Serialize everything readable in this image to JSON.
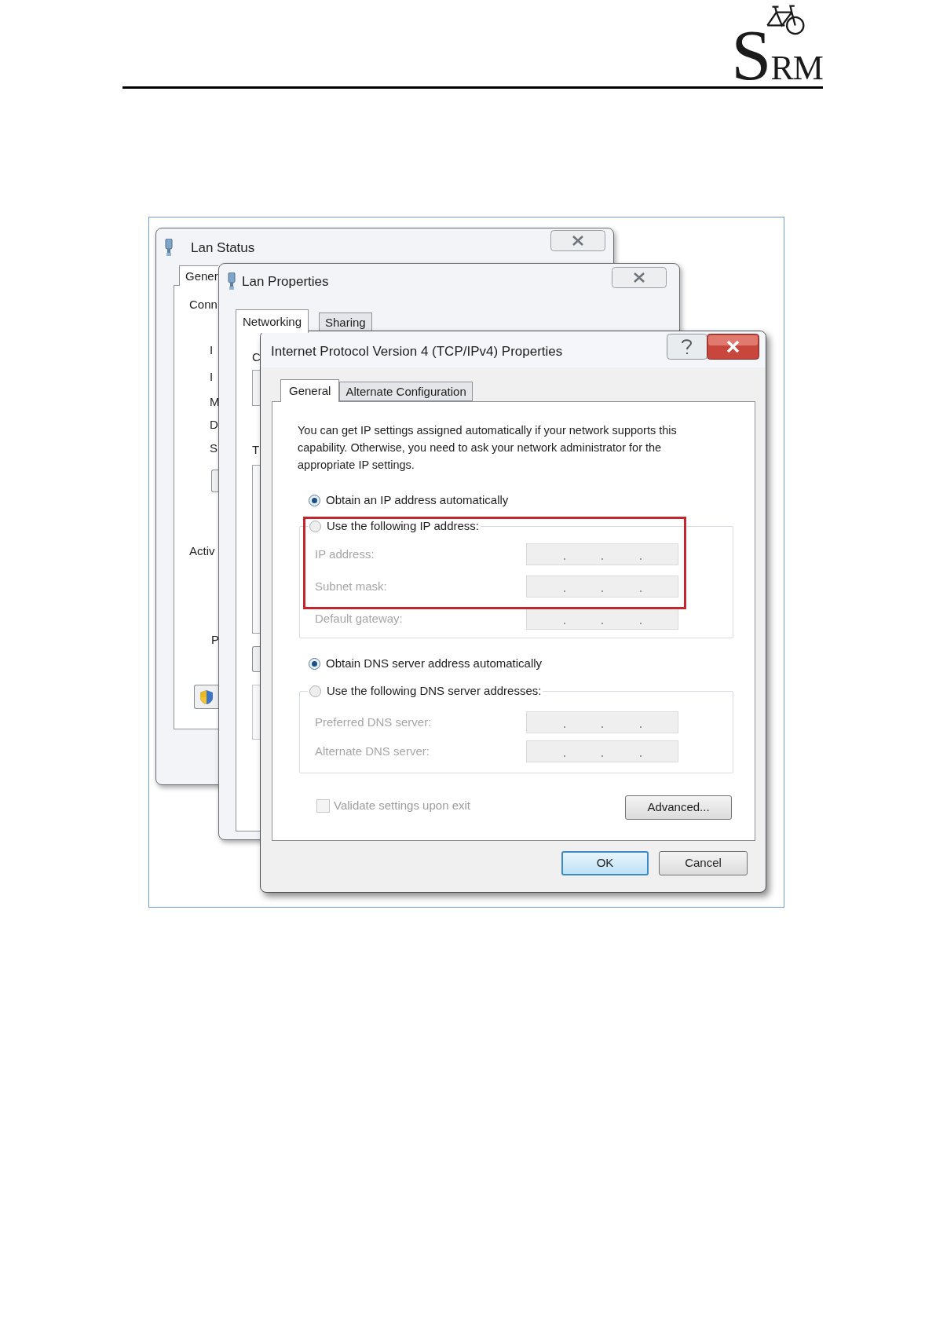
{
  "page_header": {
    "logo": "SRM"
  },
  "windows": [
    {
      "kind": "status",
      "title": "Lan Status",
      "tabs": [
        {
          "label": "Gener",
          "selected": true
        }
      ],
      "labels": [
        "Conn",
        "I",
        "I",
        "M",
        "D",
        "S",
        "Activ",
        "P"
      ]
    },
    {
      "kind": "properties",
      "title": "Lan Properties",
      "tabs": [
        {
          "label": "Networking",
          "selected": true
        },
        {
          "label": "Sharing",
          "selected": false
        }
      ],
      "labels": [
        "C",
        "T"
      ]
    },
    {
      "kind": "ipv4",
      "title": "Internet Protocol Version 4 (TCP/IPv4) Properties",
      "tabs": [
        {
          "label": "General",
          "selected": true
        },
        {
          "label": "Alternate Configuration",
          "selected": false
        }
      ],
      "description": "You can get IP settings assigned automatically if your network supports this capability. Otherwise, you need to ask your network administrator for the appropriate IP settings.",
      "ip_options": [
        {
          "label": "Obtain an IP address automatically",
          "selected": true
        },
        {
          "label": "Use the following IP address:",
          "selected": false
        }
      ],
      "ip_fields": [
        {
          "label": "IP address:",
          "disabled": true
        },
        {
          "label": "Subnet mask:",
          "disabled": true
        },
        {
          "label": "Default gateway:",
          "disabled": true
        }
      ],
      "dns_options": [
        {
          "label": "Obtain DNS server address automatically",
          "selected": true
        },
        {
          "label": "Use the following DNS server addresses:",
          "selected": false
        }
      ],
      "dns_fields": [
        {
          "label": "Preferred DNS server:",
          "disabled": true
        },
        {
          "label": "Alternate DNS server:",
          "disabled": true
        }
      ],
      "validate": {
        "label": "Validate settings upon exit",
        "checked": false,
        "disabled": true
      },
      "advanced_button": "Advanced...",
      "buttons": [
        {
          "label": "OK",
          "default": true
        },
        {
          "label": "Cancel",
          "default": false
        }
      ]
    }
  ]
}
